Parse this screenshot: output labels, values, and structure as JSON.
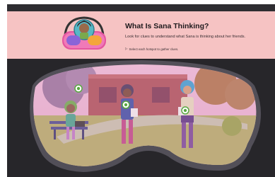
{
  "header": {
    "title": "What Is Sana Thinking?",
    "subtitle": "Look for clues to understand what Sana is thinking about her friends.",
    "instruction": "Select each hotspot to gather clues.",
    "background": "#f6c3c3"
  },
  "colors": {
    "topbar": "#2e2d31",
    "stage": "#27262a",
    "lens_tint": "#d995bf",
    "hotspot": "#5aa842"
  },
  "icons": {
    "avatar": "sana-avatar-headset",
    "instruction": "cursor-pointer-icon",
    "hotspot": "hotspot-eye-icon"
  }
}
